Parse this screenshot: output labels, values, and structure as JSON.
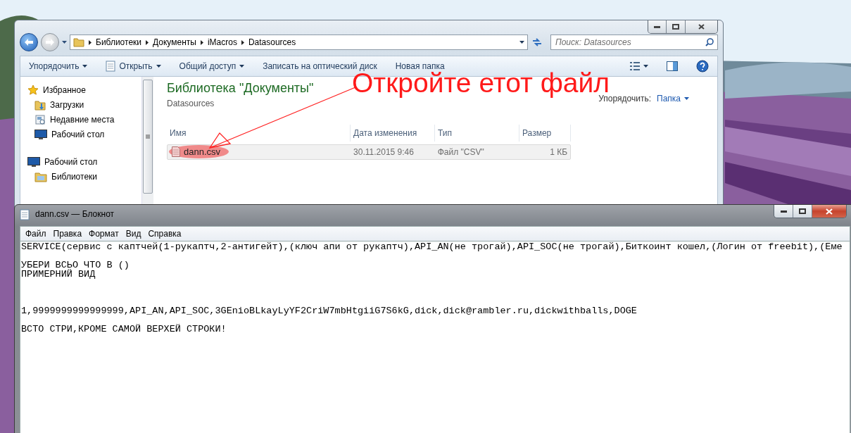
{
  "explorer": {
    "breadcrumb": [
      "Библиотеки",
      "Документы",
      "iMacros",
      "Datasources"
    ],
    "search": {
      "placeholder": "Поиск: Datasources"
    },
    "toolbar": [
      {
        "label": "Упорядочить",
        "kind": "menu"
      },
      {
        "label": "Открыть",
        "kind": "open"
      },
      {
        "label": "Общий доступ",
        "kind": "menu"
      },
      {
        "label": "Записать на оптический диск",
        "kind": "plain"
      },
      {
        "label": "Новая папка",
        "kind": "plain"
      }
    ],
    "nav_pane": [
      {
        "label": "Избранное",
        "kind": "favorites",
        "children": [
          {
            "label": "Загрузки",
            "kind": "downloads"
          },
          {
            "label": "Недавние места",
            "kind": "recent"
          },
          {
            "label": "Рабочий стол",
            "kind": "desktop"
          }
        ]
      },
      {
        "label": "Рабочий стол",
        "kind": "desktop",
        "children": [
          {
            "label": "Библиотеки",
            "kind": "libraries"
          }
        ]
      }
    ],
    "library": {
      "title": "Библиотека \"Документы\"",
      "subtitle": "Datasources",
      "arrange_label": "Упорядочить:",
      "arrange_value": "Папка"
    },
    "columns": [
      "Имя",
      "Дата изменения",
      "Тип",
      "Размер"
    ],
    "files": [
      {
        "name": "dann.csv",
        "modified": "30.11.2015 9:46",
        "type": "Файл \"CSV\"",
        "size": "1 КБ",
        "selected": true
      }
    ]
  },
  "notepad": {
    "title": "dann.csv — Блокнот",
    "menu": [
      "Файл",
      "Правка",
      "Формат",
      "Вид",
      "Справка"
    ],
    "lines": [
      {
        "kind": "text",
        "text": "SERVICE(сервис с каптчей(1-рукаптч,2-антигейт),(ключ апи от рукаптч),API_AN(не трогай),API_SOC(не трогай),Биткоинт кошел,(Логин от freebit),(Еме"
      },
      {
        "kind": "blank"
      },
      {
        "kind": "text",
        "text": "УБЕРИ ВСЬО ЧТО В ()"
      },
      {
        "kind": "text",
        "text": "ПРИМЕРНИЙ ВИД"
      },
      {
        "kind": "blank"
      },
      {
        "kind": "blank"
      },
      {
        "kind": "blank"
      },
      {
        "kind": "text",
        "text": "1,9999999999999999,API_AN,API_SOC,3GEnioBLkayLyYF2CriW7mbHtgiiG7S6kG,dick,dick@rambler.ru,dickwithballs,DOGE"
      },
      {
        "kind": "blank"
      },
      {
        "kind": "text",
        "text": "ВСТО СТРИ,КРОМЕ САМОЙ ВЕРХЕЙ СТРОКИ!"
      }
    ]
  },
  "annotation": {
    "text": "Откройте етот файл"
  }
}
